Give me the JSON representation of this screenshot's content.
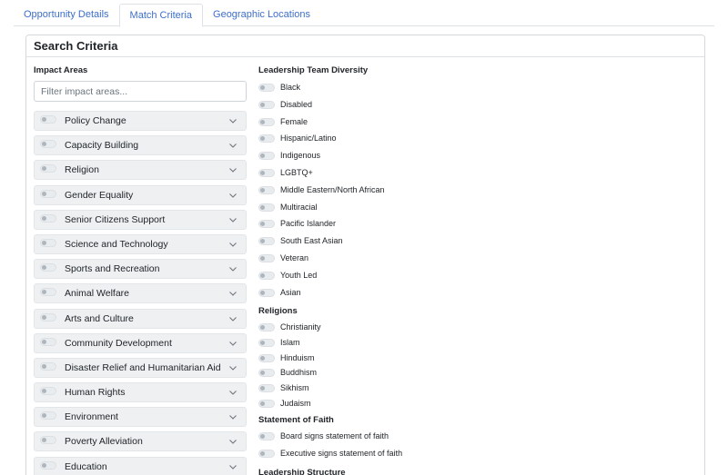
{
  "tabs": [
    {
      "label": "Opportunity Details",
      "active": false
    },
    {
      "label": "Match Criteria",
      "active": true
    },
    {
      "label": "Geographic Locations",
      "active": false
    }
  ],
  "card": {
    "title": "Search Criteria"
  },
  "impact": {
    "label": "Impact Areas",
    "filter_placeholder": "Filter impact areas...",
    "items": [
      "Policy Change",
      "Capacity Building",
      "Religion",
      "Gender Equality",
      "Senior Citizens Support",
      "Science and Technology",
      "Sports and Recreation",
      "Animal Welfare",
      "Arts and Culture",
      "Community Development",
      "Disaster Relief and Humanitarian Aid",
      "Human Rights",
      "Environment",
      "Poverty Alleviation",
      "Education"
    ]
  },
  "diversity": {
    "label": "Leadership Team Diversity",
    "items": [
      "Black",
      "Disabled",
      "Female",
      "Hispanic/Latino",
      "Indigenous",
      "LGBTQ+",
      "Middle Eastern/North African",
      "Multiracial",
      "Pacific Islander",
      "South East Asian",
      "Veteran",
      "Youth Led",
      "Asian"
    ]
  },
  "religions": {
    "label": "Religions",
    "items": [
      "Christianity",
      "Islam",
      "Hinduism",
      "Buddhism",
      "Sikhism",
      "Judaism"
    ]
  },
  "faith": {
    "label": "Statement of Faith",
    "items": [
      "Board signs statement of faith",
      "Executive signs statement of faith"
    ]
  },
  "structure": {
    "label": "Leadership Structure"
  }
}
